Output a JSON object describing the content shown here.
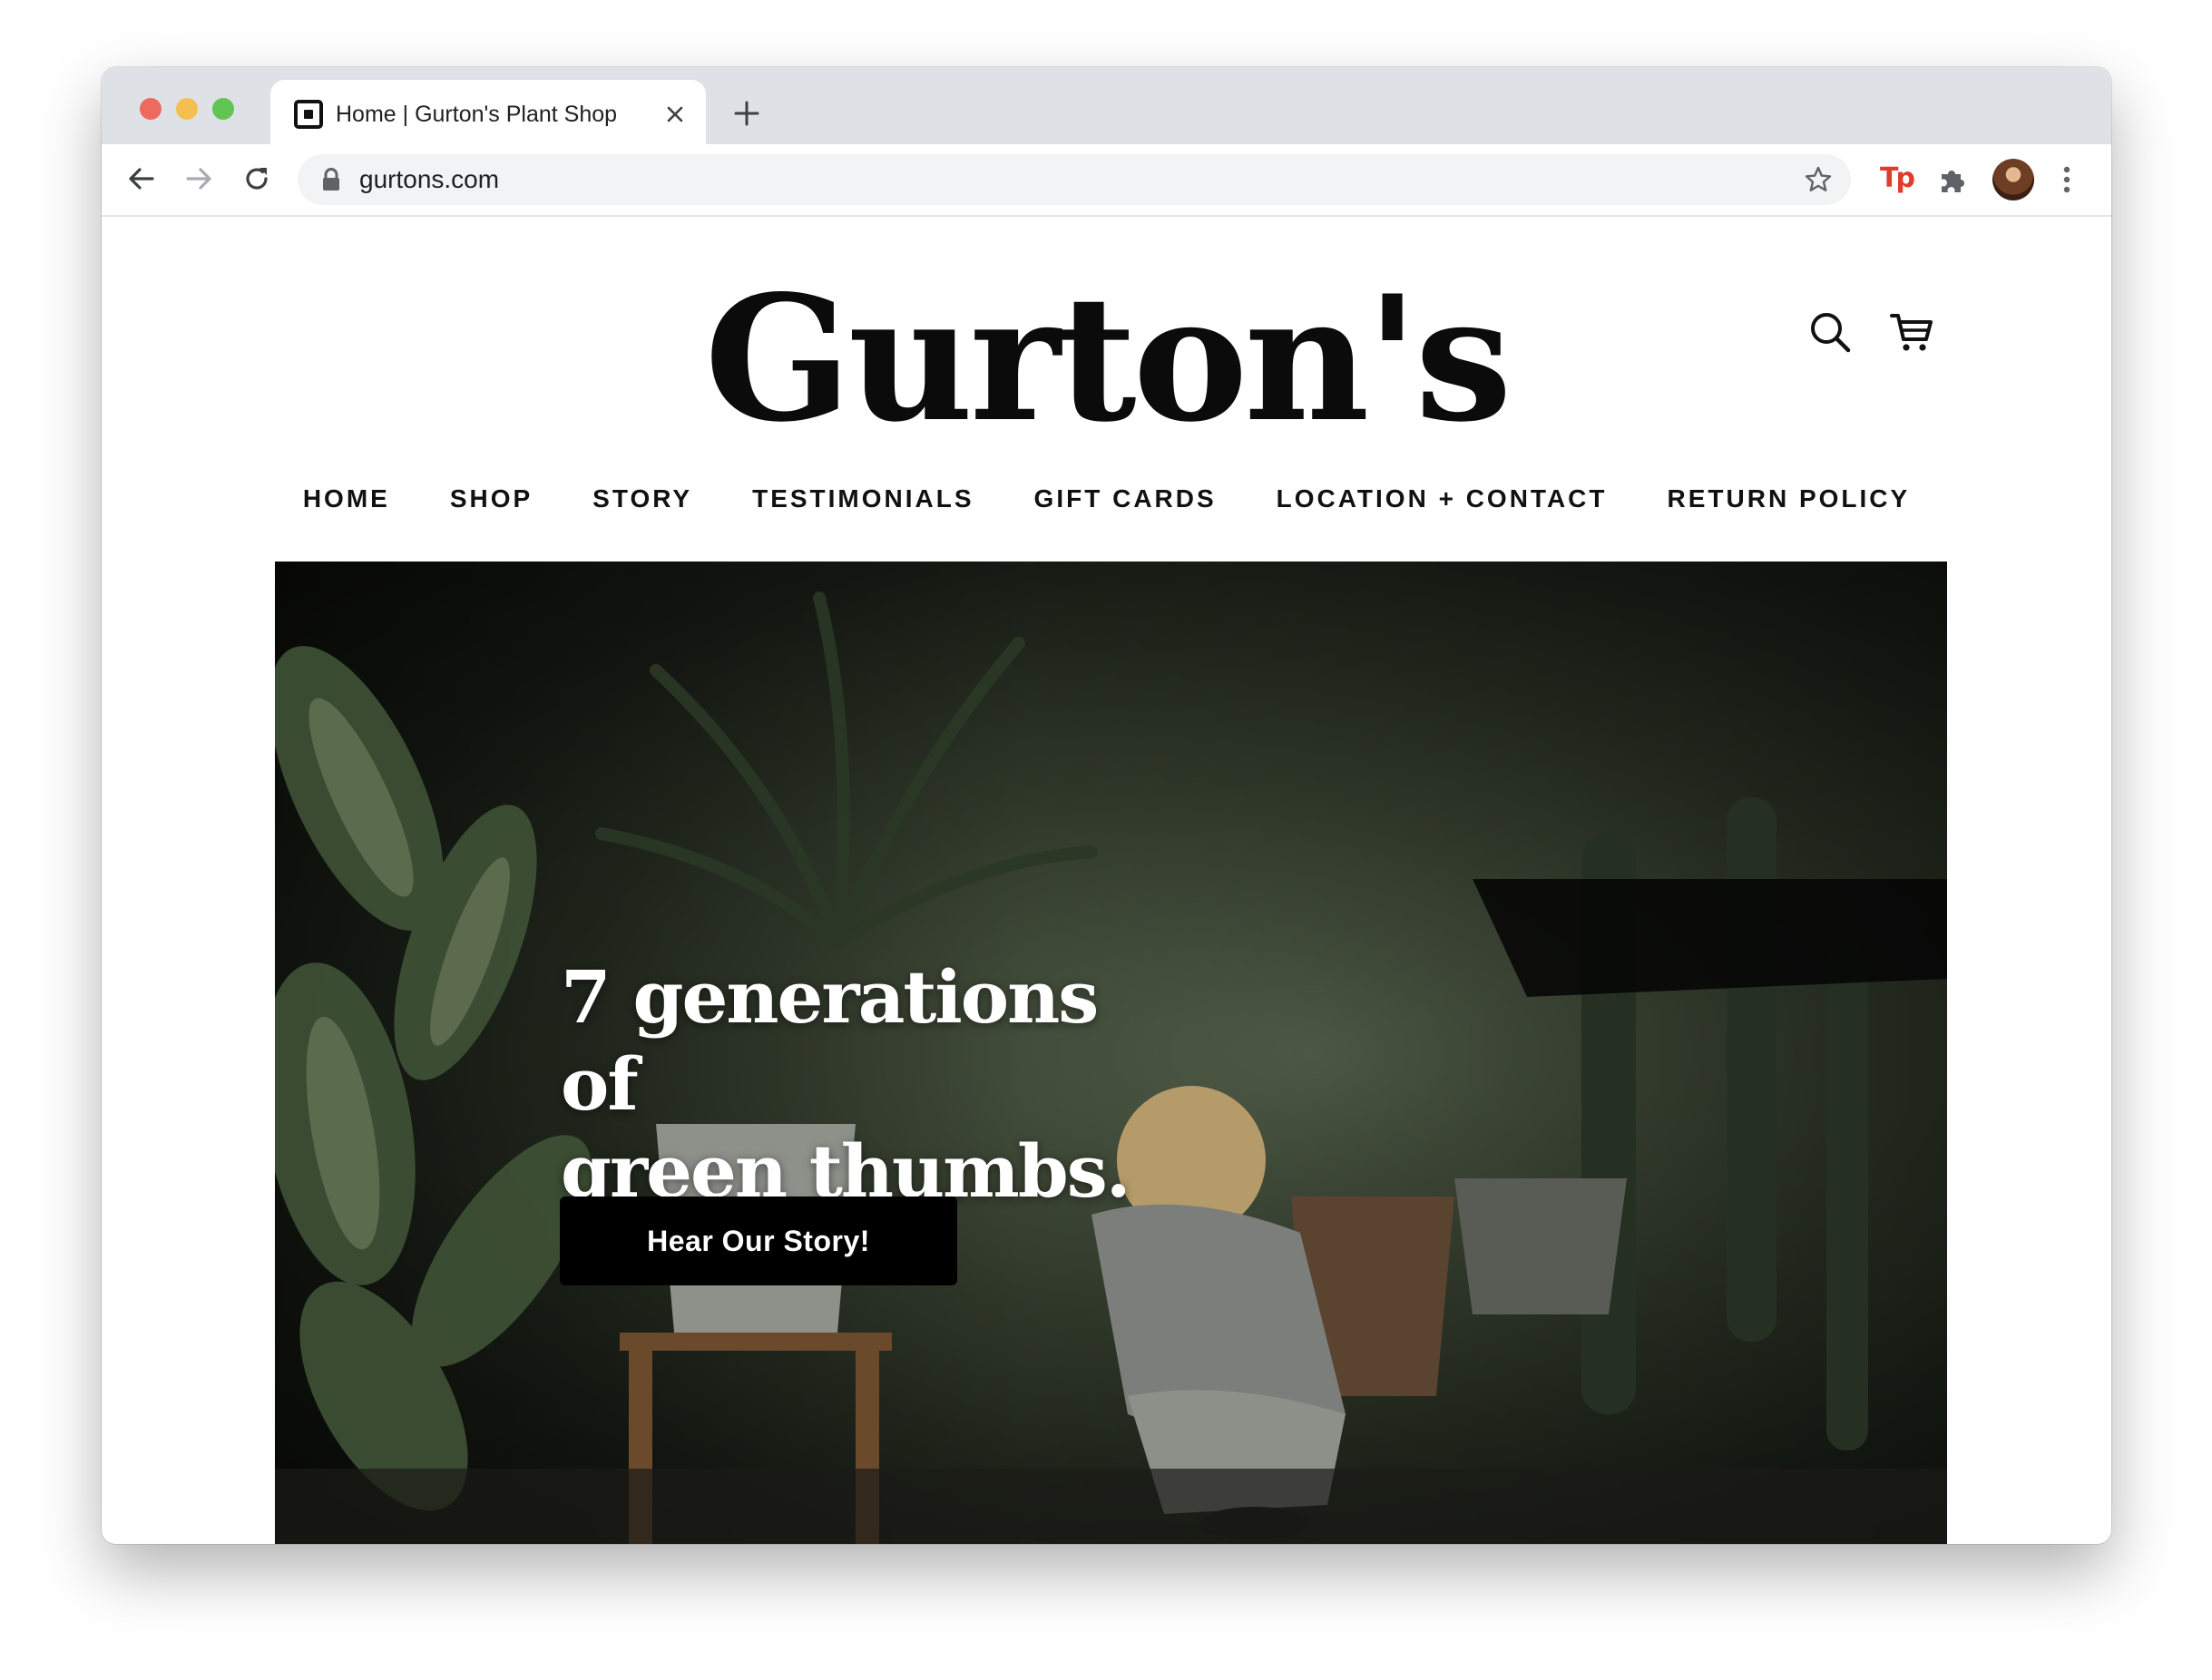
{
  "browser": {
    "tab_title": "Home | Gurton's Plant Shop",
    "url": "gurtons.com",
    "extension_label": "Tp"
  },
  "site": {
    "logo": "Gurton's",
    "nav": [
      "HOME",
      "SHOP",
      "STORY",
      "TESTIMONIALS",
      "GIFT CARDS",
      "LOCATION + CONTACT",
      "RETURN POLICY"
    ]
  },
  "hero": {
    "heading_line1": "7 generations of",
    "heading_line2": "green thumbs.",
    "button_label": "Hear Our Story!"
  },
  "colors": {
    "tabstrip": "#dee1e6",
    "extension": "#e23b2e",
    "button": "#000000",
    "hero_overlay": "#0b0d09"
  },
  "icons": [
    "close-icon",
    "plus-icon",
    "back-arrow-icon",
    "forward-arrow-icon",
    "reload-icon",
    "lock-icon",
    "star-icon",
    "puzzle-icon",
    "kebab-menu-icon",
    "search-icon",
    "cart-icon"
  ]
}
